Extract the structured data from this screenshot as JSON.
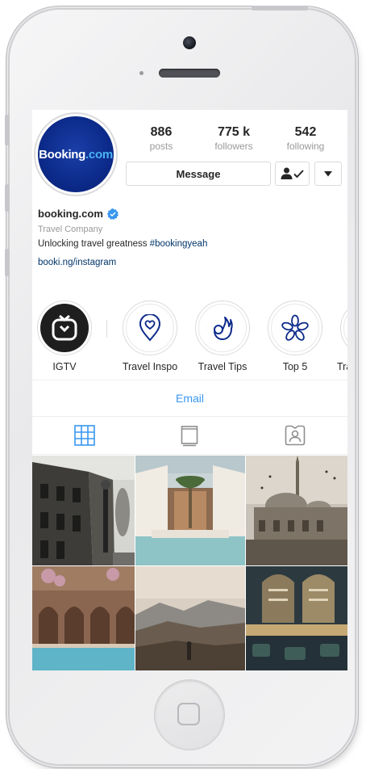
{
  "profile": {
    "logo_text_main": "Booking",
    "logo_text_suffix": ".com",
    "username": "booking.com",
    "category": "Travel Company",
    "bio_text": "Unlocking travel greatness ",
    "bio_hashtag": "#bookingyeah",
    "link": "booki.ng/instagram"
  },
  "stats": [
    {
      "value": "886",
      "label": "posts"
    },
    {
      "value": "775 k",
      "label": "followers"
    },
    {
      "value": "542",
      "label": "following"
    }
  ],
  "actions": {
    "message_label": "Message",
    "following_icon": "person-check-icon",
    "more_icon": "dropdown-caret-icon"
  },
  "highlights": [
    {
      "label": "IGTV",
      "icon": "igtv-icon"
    },
    {
      "label": "Travel Inspo",
      "icon": "heart-pin-icon"
    },
    {
      "label": "Travel Tips",
      "icon": "ok-hand-icon"
    },
    {
      "label": "Top 5",
      "icon": "star-petals-icon"
    },
    {
      "label": "Tra",
      "icon": "highlight-icon"
    }
  ],
  "email_label": "Email",
  "tabs": [
    {
      "icon": "grid-icon",
      "active": true
    },
    {
      "icon": "igtv-feed-icon",
      "active": false
    },
    {
      "icon": "tagged-person-icon",
      "active": false
    }
  ],
  "colors": {
    "brand_blue": "#0c2a8a",
    "link_blue": "#3897f0",
    "verified_blue": "#3897f0",
    "text": "#262626",
    "muted": "#999999"
  }
}
